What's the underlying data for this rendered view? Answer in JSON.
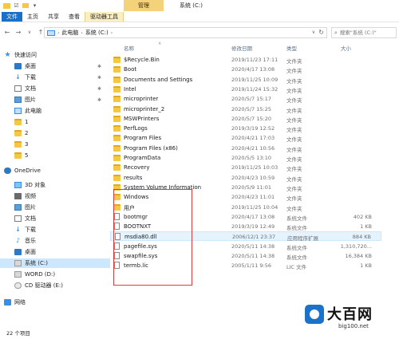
{
  "window": {
    "title": "系统 (C:)",
    "manage_tab": "管理"
  },
  "ribbon": {
    "tabs": [
      "文件",
      "主页",
      "共享",
      "查看",
      "驱动器工具"
    ]
  },
  "address": {
    "crumbs": [
      "此电脑",
      "系统 (C:)"
    ]
  },
  "search": {
    "placeholder": "搜索\"系统 (C:)\""
  },
  "columns": {
    "name": "名称",
    "date": "修改日期",
    "type": "类型",
    "size": "大小"
  },
  "nav": {
    "quick_access": "快速访问",
    "quick_items": [
      "桌面",
      "下载",
      "文档",
      "图片"
    ],
    "this_pc_label": "此电脑",
    "folders": [
      "1",
      "2",
      "3",
      "5"
    ],
    "onedrive": "OneDrive",
    "pc_items": [
      "3D 对象",
      "视频",
      "图片",
      "文档",
      "下载",
      "音乐",
      "桌面",
      "系统 (C:)",
      "WORD (D:)",
      "CD 驱动器 (E:)"
    ],
    "network": "网络"
  },
  "files": [
    {
      "name": "$Recycle.Bin",
      "date": "2019/11/23 17:11",
      "type": "文件夹",
      "size": "",
      "kind": "folder"
    },
    {
      "name": "Boot",
      "date": "2020/4/17 13:08",
      "type": "文件夹",
      "size": "",
      "kind": "folder"
    },
    {
      "name": "Documents and Settings",
      "date": "2019/11/25 10:09",
      "type": "文件夹",
      "size": "",
      "kind": "folder"
    },
    {
      "name": "Intel",
      "date": "2019/11/24 15:32",
      "type": "文件夹",
      "size": "",
      "kind": "folder"
    },
    {
      "name": "microprinter",
      "date": "2020/5/7 15:17",
      "type": "文件夹",
      "size": "",
      "kind": "folder"
    },
    {
      "name": "microprinter_2",
      "date": "2020/5/7 15:25",
      "type": "文件夹",
      "size": "",
      "kind": "folder"
    },
    {
      "name": "MSWPrinters",
      "date": "2020/5/7 15:20",
      "type": "文件夹",
      "size": "",
      "kind": "folder"
    },
    {
      "name": "PerfLogs",
      "date": "2019/3/19 12:52",
      "type": "文件夹",
      "size": "",
      "kind": "folder"
    },
    {
      "name": "Program Files",
      "date": "2020/4/21 17:03",
      "type": "文件夹",
      "size": "",
      "kind": "folder"
    },
    {
      "name": "Program Files (x86)",
      "date": "2020/4/21 10:56",
      "type": "文件夹",
      "size": "",
      "kind": "folder"
    },
    {
      "name": "ProgramData",
      "date": "2020/5/5 13:10",
      "type": "文件夹",
      "size": "",
      "kind": "folder"
    },
    {
      "name": "Recovery",
      "date": "2019/11/25 10:03",
      "type": "文件夹",
      "size": "",
      "kind": "folder"
    },
    {
      "name": "results",
      "date": "2020/4/23 10:59",
      "type": "文件夹",
      "size": "",
      "kind": "folder"
    },
    {
      "name": "System Volume Information",
      "date": "2020/5/9 11:01",
      "type": "文件夹",
      "size": "",
      "kind": "folder"
    },
    {
      "name": "Windows",
      "date": "2020/4/23 11:01",
      "type": "文件夹",
      "size": "",
      "kind": "folder"
    },
    {
      "name": "用户",
      "date": "2019/11/25 10:04",
      "type": "文件夹",
      "size": "",
      "kind": "folder"
    },
    {
      "name": "bootmgr",
      "date": "2020/4/17 13:08",
      "type": "系统文件",
      "size": "402 KB",
      "kind": "file"
    },
    {
      "name": "BOOTNXT",
      "date": "2019/3/19 12:49",
      "type": "系统文件",
      "size": "1 KB",
      "kind": "file"
    },
    {
      "name": "msdia80.dll",
      "date": "2006/12/1 23:37",
      "type": "应用程序扩展",
      "size": "884 KB",
      "kind": "gear"
    },
    {
      "name": "pagefile.sys",
      "date": "2020/5/11 14:38",
      "type": "系统文件",
      "size": "1,310,720...",
      "kind": "file"
    },
    {
      "name": "swapfile.sys",
      "date": "2020/5/11 14:38",
      "type": "系统文件",
      "size": "16,384 KB",
      "kind": "file"
    },
    {
      "name": "termb.lic",
      "date": "2005/1/11 9:56",
      "type": "LIC 文件",
      "size": "1 KB",
      "kind": "file"
    }
  ],
  "status": {
    "count": "22 个项目"
  },
  "watermark": {
    "brand": "大百网",
    "url": "big100.net"
  }
}
